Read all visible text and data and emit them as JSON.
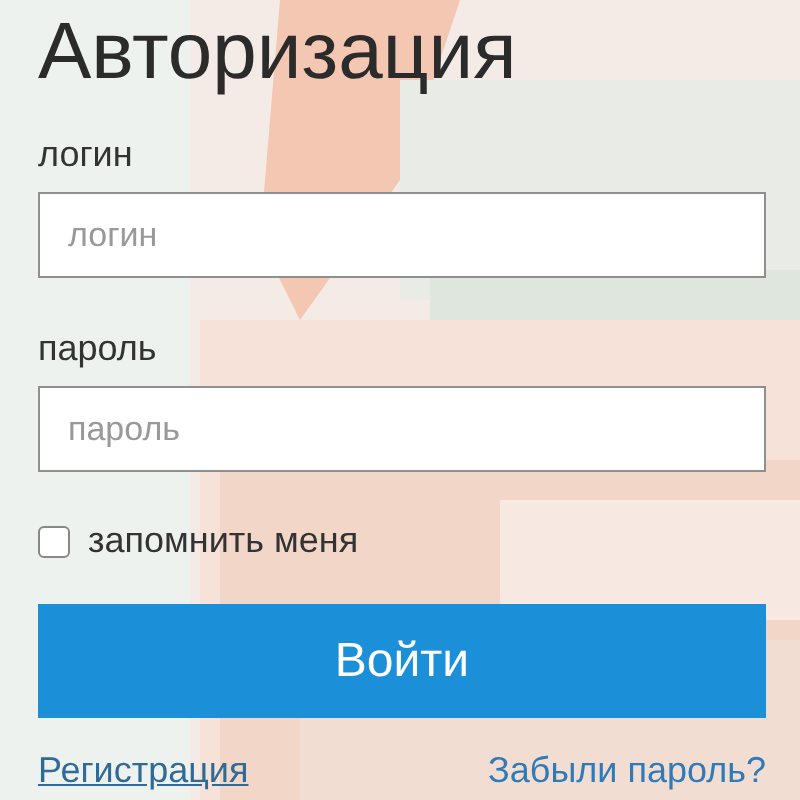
{
  "title": "Авторизация",
  "fields": [
    {
      "label": "логин",
      "placeholder": "логин"
    },
    {
      "label": "пароль",
      "placeholder": "пароль"
    }
  ],
  "remember": {
    "label": "запомнить меня",
    "checked": false
  },
  "submit": "Войти",
  "links": [
    {
      "text": "Регистрация",
      "kind": "underlined"
    },
    {
      "text": "Забыли пароль?",
      "kind": "plain"
    }
  ]
}
